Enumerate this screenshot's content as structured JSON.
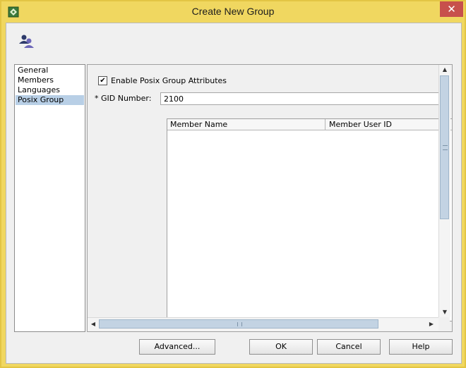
{
  "window": {
    "title": "Create New Group",
    "close_glyph": "✕",
    "app_icon": "app-icon",
    "accent_color": "#f0d760"
  },
  "header": {
    "icon": "group-icon"
  },
  "nav": {
    "items": [
      {
        "label": "General",
        "selected": false
      },
      {
        "label": "Members",
        "selected": false
      },
      {
        "label": "Languages",
        "selected": false
      },
      {
        "label": "Posix Group",
        "selected": true
      }
    ],
    "selected_color": "#b8cfe6"
  },
  "posix": {
    "enable_label": "Enable Posix Group Attributes",
    "enable_checked": true,
    "check_glyph": "✔",
    "gid_label": "* GID Number:",
    "gid_value": "2100",
    "table": {
      "columns": [
        "Member Name",
        "Member User ID"
      ],
      "rows": []
    }
  },
  "scrollbars": {
    "up_glyph": "▲",
    "down_glyph": "▼",
    "left_glyph": "◀",
    "right_glyph": "▶"
  },
  "buttons": {
    "advanced": "Advanced...",
    "ok": "OK",
    "cancel": "Cancel",
    "help": "Help"
  }
}
